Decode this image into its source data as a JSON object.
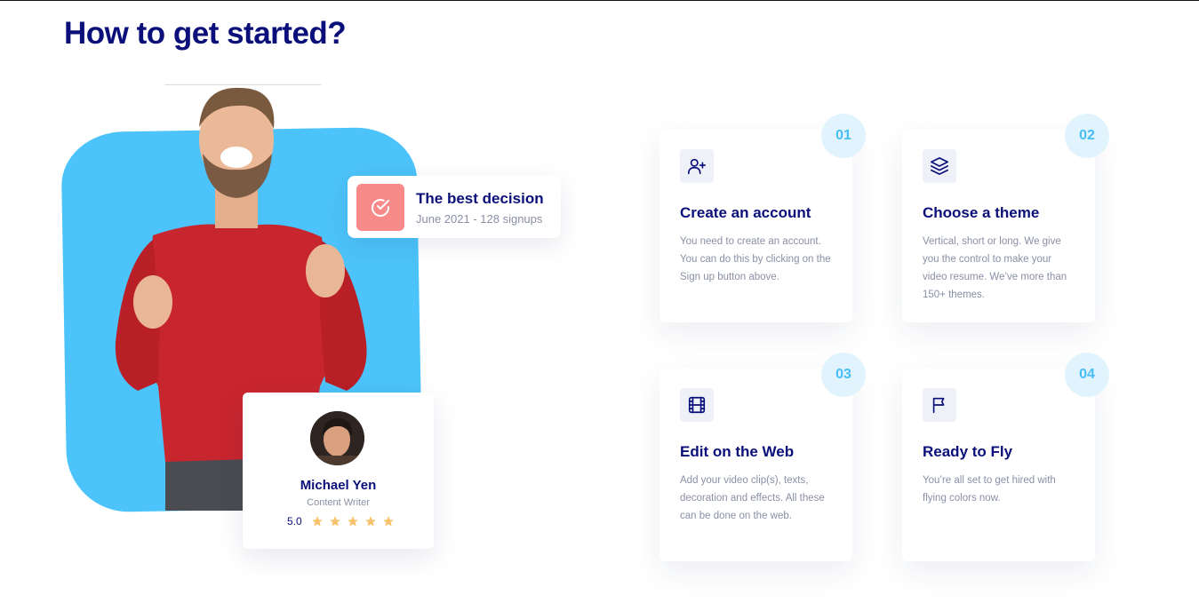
{
  "section": {
    "title": "How to get started?"
  },
  "badge": {
    "title": "The best decision",
    "subtitle": "June 2021 - 128 signups",
    "icon": "check-circle-icon",
    "color": "#f98a8a"
  },
  "profile": {
    "name": "Michael Yen",
    "role": "Content Writer",
    "rating": "5.0",
    "stars": 5
  },
  "colors": {
    "accent": "#4cc3fa",
    "title": "#0a0f7a",
    "step_number": "#46bdf5",
    "star": "#f6c26b"
  },
  "steps": [
    {
      "number": "01",
      "icon": "user-plus-icon",
      "title": "Create an account",
      "description": "You need to create an account. You can do this by clicking on the Sign up button above."
    },
    {
      "number": "02",
      "icon": "layers-icon",
      "title": "Choose a theme",
      "description": "Vertical, short or long. We give you the control to make your video resume. We’ve more than 150+ themes."
    },
    {
      "number": "03",
      "icon": "film-icon",
      "title": "Edit on the Web",
      "description": "Add your video clip(s), texts, decoration and effects. All these can be done on the web."
    },
    {
      "number": "04",
      "icon": "flag-icon",
      "title": "Ready to Fly",
      "description": "You’re all set to get hired with flying colors now."
    }
  ]
}
